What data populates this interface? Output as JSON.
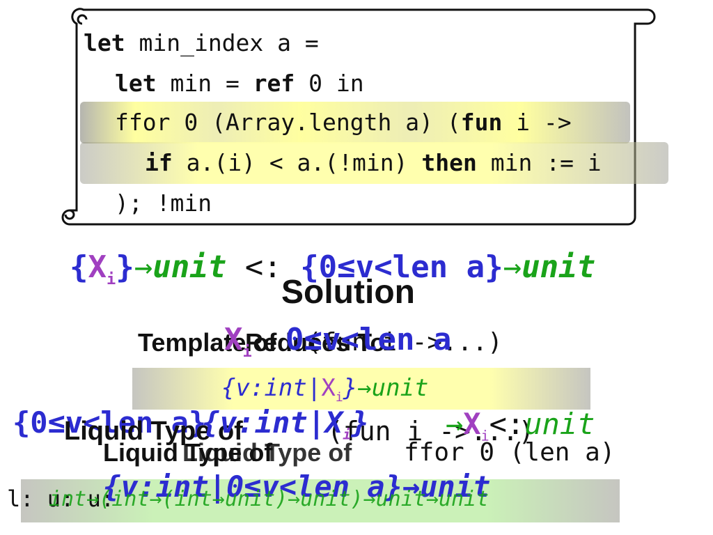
{
  "code": {
    "line1_kw": "let",
    "line1_rest": " min_index a =",
    "line2_kw": "let",
    "line2_mid": " min = ",
    "line2_kw2": "ref",
    "line2_rest": " 0 in",
    "line3_a": "ffor 0 (Array.length a) (",
    "line3_kw": "fun",
    "line3_b": " i ->",
    "line4_kw": "if",
    "line4_mid": " a.(i) < a.(!min) ",
    "line4_kw2": "then",
    "line4_rest": " min := i",
    "line5": "); !min"
  },
  "subtyping": {
    "lhs_open": "{",
    "lhs_var": "X",
    "lhs_sub": "i",
    "lhs_close": "}",
    "arrow": "→",
    "unit": "unit",
    "op": " <: ",
    "rhs": "{0≤v<len a}",
    "arrow2": "→",
    "unit2": "unit"
  },
  "solution_title": "Solution",
  "template": {
    "label": "Template of",
    "call": "(fun i ->...)",
    "reduces": "Reduces To",
    "xi": "X",
    "xi_sub": "i",
    "refinement": "0≤v<len a"
  },
  "template_type": {
    "open": "{",
    "v": "v:int",
    "bar": "|",
    "x": "X",
    "x_sub": "i",
    "close": "}",
    "arrow": "→",
    "unit": "unit"
  },
  "liquid": {
    "left": "{0≤v<len a}",
    "label": "Liquid Type of",
    "call": "(fun i ->...)",
    "mid": "{v:int|X",
    "mid_sub": "i",
    "mid_close": "}",
    "arrow": "→",
    "xi": "X",
    "xi_sub": "i",
    "op": "<:",
    "unit": "unit"
  },
  "liquid2": {
    "label": "Liquid Type of",
    "call": "ffor 0 (len a)",
    "prefix_label": "Liquid Type of"
  },
  "bottom": {
    "prefix": "l: u: u:",
    "text": "{v:int|0≤v<len a}→unit",
    "overlay": "int→(int→(int→unit)→unit)→unit→unit"
  }
}
